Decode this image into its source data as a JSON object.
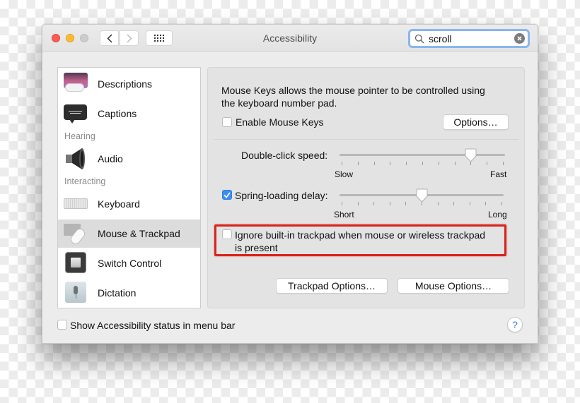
{
  "window": {
    "title": "Accessibility",
    "nav": {
      "back_icon": "chevron-left-icon",
      "forward_icon": "chevron-right-icon",
      "show_all_icon": "grid-icon"
    },
    "search": {
      "value": "scroll",
      "icon": "search-icon",
      "clear_icon": "clear-icon"
    }
  },
  "sidebar": {
    "items": [
      {
        "label": "Descriptions",
        "icon": "descriptions-icon",
        "selected": false
      },
      {
        "label": "Captions",
        "icon": "captions-icon",
        "selected": false
      },
      {
        "header": "Hearing"
      },
      {
        "label": "Audio",
        "icon": "speaker-icon",
        "selected": false
      },
      {
        "header": "Interacting"
      },
      {
        "label": "Keyboard",
        "icon": "keyboard-icon",
        "selected": false
      },
      {
        "label": "Mouse & Trackpad",
        "icon": "mouse-trackpad-icon",
        "selected": true
      },
      {
        "label": "Switch Control",
        "icon": "switch-control-icon",
        "selected": false
      },
      {
        "label": "Dictation",
        "icon": "microphone-icon",
        "selected": false
      }
    ]
  },
  "panel": {
    "description_line1": "Mouse Keys allows the mouse pointer to be controlled using",
    "description_line2": "the keyboard number pad.",
    "enable_mouse_keys": {
      "label": "Enable Mouse Keys",
      "checked": false
    },
    "options_button": "Options…",
    "double_click": {
      "label": "Double-click speed:",
      "min_label": "Slow",
      "max_label": "Fast",
      "ticks": 11,
      "value_fraction": 0.8
    },
    "spring_loading": {
      "label": "Spring-loading delay:",
      "checked": true,
      "min_label": "Short",
      "max_label": "Long",
      "ticks": 11,
      "value_fraction": 0.5
    },
    "ignore_trackpad": {
      "label_line1": "Ignore built-in trackpad when mouse or wireless trackpad",
      "label_line2": "is present",
      "checked": false,
      "highlighted": true
    },
    "trackpad_options_button": "Trackpad Options…",
    "mouse_options_button": "Mouse Options…"
  },
  "footer": {
    "show_status": {
      "label": "Show Accessibility status in menu bar",
      "checked": false
    },
    "help_label": "?"
  },
  "colors": {
    "accent": "#3c8ff4",
    "highlight": "#d8231c",
    "search_focus": "#8ab6ec"
  }
}
